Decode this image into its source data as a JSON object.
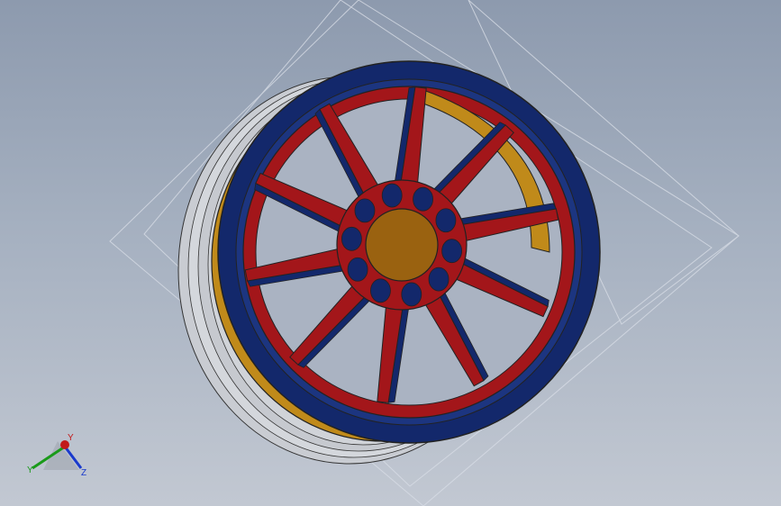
{
  "viewport": {
    "background_top": "#8d9aae",
    "background_bottom": "#c2c8d2"
  },
  "model": {
    "description_colors": {
      "rim": "#13286b",
      "spokes": "#a3161a",
      "hub": "#9a6210",
      "inner_barrel": "#c08a1a",
      "tire_sidewall": "#c9ccd2",
      "outline": "#222222"
    },
    "spoke_count": 10
  },
  "triad": {
    "x_label": "Y",
    "y_label": "Y",
    "z_label": "Z",
    "x_color": "#c21a1a",
    "y_color": "#1a9a1a",
    "z_color": "#1a3acc"
  }
}
